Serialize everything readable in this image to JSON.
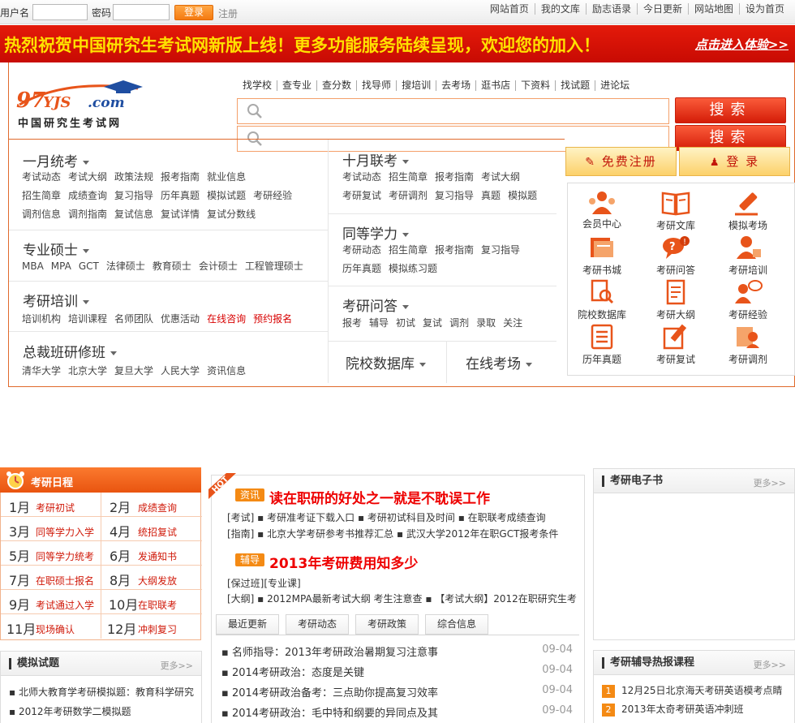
{
  "login": {
    "username_label": "用户名",
    "password_label": "密码",
    "login_button": "登录",
    "register_link": "注册"
  },
  "top_links": [
    "网站首页",
    "我的文库",
    "励志语录",
    "今日更新",
    "网站地图",
    "设为首页"
  ],
  "banner": {
    "text": "热烈祝贺中国研究生考试网新版上线！更多功能服务陆续呈现，欢迎您的加入！",
    "link": "点击进入体验>>"
  },
  "logo": {
    "text": "97YJS.com",
    "subtitle": "中国研究生考试网"
  },
  "top_nav": [
    "找学校",
    "查专业",
    "查分数",
    "找导师",
    "搜培训",
    "去考场",
    "逛书店",
    "下资料",
    "找试题",
    "进论坛"
  ],
  "search": {
    "placeholder": "",
    "button": "搜索"
  },
  "categories": {
    "yiyue": {
      "title": "一月统考",
      "rows": [
        [
          "考试动态",
          "考试大纲",
          "政策法规",
          "报考指南",
          "就业信息"
        ],
        [
          "招生简章",
          "成绩查询",
          "复习指导",
          "历年真题",
          "模拟试题",
          "考研经验"
        ],
        [
          "调剂信息",
          "调剂指南",
          "复试信息",
          "复试详情",
          "复试分数线"
        ]
      ]
    },
    "zhuanshuo": {
      "title": "专业硕士",
      "rows": [
        [
          "MBA",
          "MPA",
          "GCT",
          "法律硕士",
          "教育硕士",
          "会计硕士",
          "工程管理硕士"
        ]
      ]
    },
    "peixun": {
      "title": "考研培训",
      "rows": [
        [
          "培训机构",
          "培训课程",
          "名师团队",
          "优惠活动",
          "在线咨询",
          "预约报名"
        ]
      ]
    },
    "zongcai": {
      "title": "总裁班研修班",
      "rows": [
        [
          "清华大学",
          "北京大学",
          "复旦大学",
          "人民大学",
          "资讯信息"
        ]
      ]
    },
    "shiyue": {
      "title": "十月联考",
      "rows": [
        [
          "考试动态",
          "招生简章",
          "报考指南",
          "考试大纲"
        ],
        [
          "考研复试",
          "考研调剂",
          "复习指导",
          "真题",
          "模拟题"
        ]
      ]
    },
    "tongdeng": {
      "title": "同等学力",
      "rows": [
        [
          "考研动态",
          "招生简章",
          "报考指南",
          "复习指导"
        ],
        [
          "历年真题",
          "模拟练习题"
        ]
      ]
    },
    "wenda": {
      "title": "考研问答",
      "rows": [
        [
          "报考",
          "辅导",
          "初试",
          "复试",
          "调剂",
          "录取",
          "关注"
        ]
      ]
    },
    "yuanxiao": {
      "title": "院校数据库"
    },
    "kaochang": {
      "title": "在线考场"
    }
  },
  "account": {
    "register": "免费注册",
    "login": "登 录"
  },
  "icon_grid": [
    {
      "label": "会员中心",
      "icon": "members-icon",
      "color": "#e8541a"
    },
    {
      "label": "考研文库",
      "icon": "library-icon",
      "color": "#e8541a"
    },
    {
      "label": "模拟考场",
      "icon": "exam-pen-icon",
      "color": "#e8541a"
    },
    {
      "label": "考研书城",
      "icon": "books-icon",
      "color": "#e8541a"
    },
    {
      "label": "考研问答",
      "icon": "qa-icon",
      "color": "#e8541a"
    },
    {
      "label": "考研培训",
      "icon": "training-icon",
      "color": "#e8541a"
    },
    {
      "label": "院校数据库",
      "icon": "search-doc-icon",
      "color": "#e8541a"
    },
    {
      "label": "考研大纲",
      "icon": "outline-icon",
      "color": "#e8541a"
    },
    {
      "label": "考研经验",
      "icon": "experience-icon",
      "color": "#e8541a"
    },
    {
      "label": "历年真题",
      "icon": "past-papers-icon",
      "color": "#e8541a"
    },
    {
      "label": "考研复试",
      "icon": "retest-icon",
      "color": "#e8541a"
    },
    {
      "label": "考研调剂",
      "icon": "adjust-icon",
      "color": "#e8541a"
    }
  ],
  "schedule": {
    "title": "考研日程",
    "items": [
      {
        "month": "1月",
        "text": "考研初试"
      },
      {
        "month": "2月",
        "text": "成绩查询"
      },
      {
        "month": "3月",
        "text": "同等学力入学"
      },
      {
        "month": "4月",
        "text": "统招复试"
      },
      {
        "month": "5月",
        "text": "同等学力统考"
      },
      {
        "month": "6月",
        "text": "发通知书"
      },
      {
        "month": "7月",
        "text": "在职硕士报名"
      },
      {
        "month": "8月",
        "text": "大纲发放"
      },
      {
        "month": "9月",
        "text": "考试通过入学"
      },
      {
        "month": "10月",
        "text": "在职联考"
      },
      {
        "month": "11月",
        "text": "现场确认"
      },
      {
        "month": "12月",
        "text": "冲刺复习"
      }
    ]
  },
  "mock": {
    "title": "模拟试题",
    "more": "更多>>",
    "items": [
      "北师大教育学考研模拟题：教育科学研究",
      "2012年考研数学二模拟题"
    ]
  },
  "news": {
    "hot": "HOT",
    "tag1": "资讯",
    "headline1": "读在职研的好处之一就是不耽误工作",
    "row1": "[考试]  ▪ 考研准考证下载入口   ▪ 考研初试科目及时间   ▪ 在职联考成绩查询",
    "row2": "[指南]  ▪ 北京大学考研参考书推荐汇总   ▪ 武汉大学2012年在职GCT报考条件",
    "tag2": "辅导",
    "headline2": "2013年考研费用知多少",
    "row3": "[保过班][专业课]",
    "row4": "[大纲]  ▪ 2012MPA最新考试大纲 考生注意查   ▪ 【考试大纲】2012在职研究生考",
    "tabs": [
      "最近更新",
      "考研动态",
      "考研政策",
      "综合信息"
    ],
    "list": [
      {
        "title": "▪ 名师指导：2013年考研政治暑期复习注意事",
        "date": "09-04"
      },
      {
        "title": "▪ 2014考研政治：态度是关键",
        "date": "09-04"
      },
      {
        "title": "▪ 2014考研政治备考：三点助你提高复习效率",
        "date": "09-04"
      },
      {
        "title": "▪ 2014考研政治：毛中特和纲要的异同点及其",
        "date": "09-04"
      }
    ]
  },
  "ebook": {
    "title": "考研电子书",
    "more": "更多>>"
  },
  "courses": {
    "title": "考研辅导热报课程",
    "more": "更多>>",
    "items": [
      {
        "rank": "1",
        "text": "12月25日北京海天考研英语模考点睛"
      },
      {
        "rank": "2",
        "text": "2013年太奇考研英语冲刺班"
      }
    ]
  }
}
